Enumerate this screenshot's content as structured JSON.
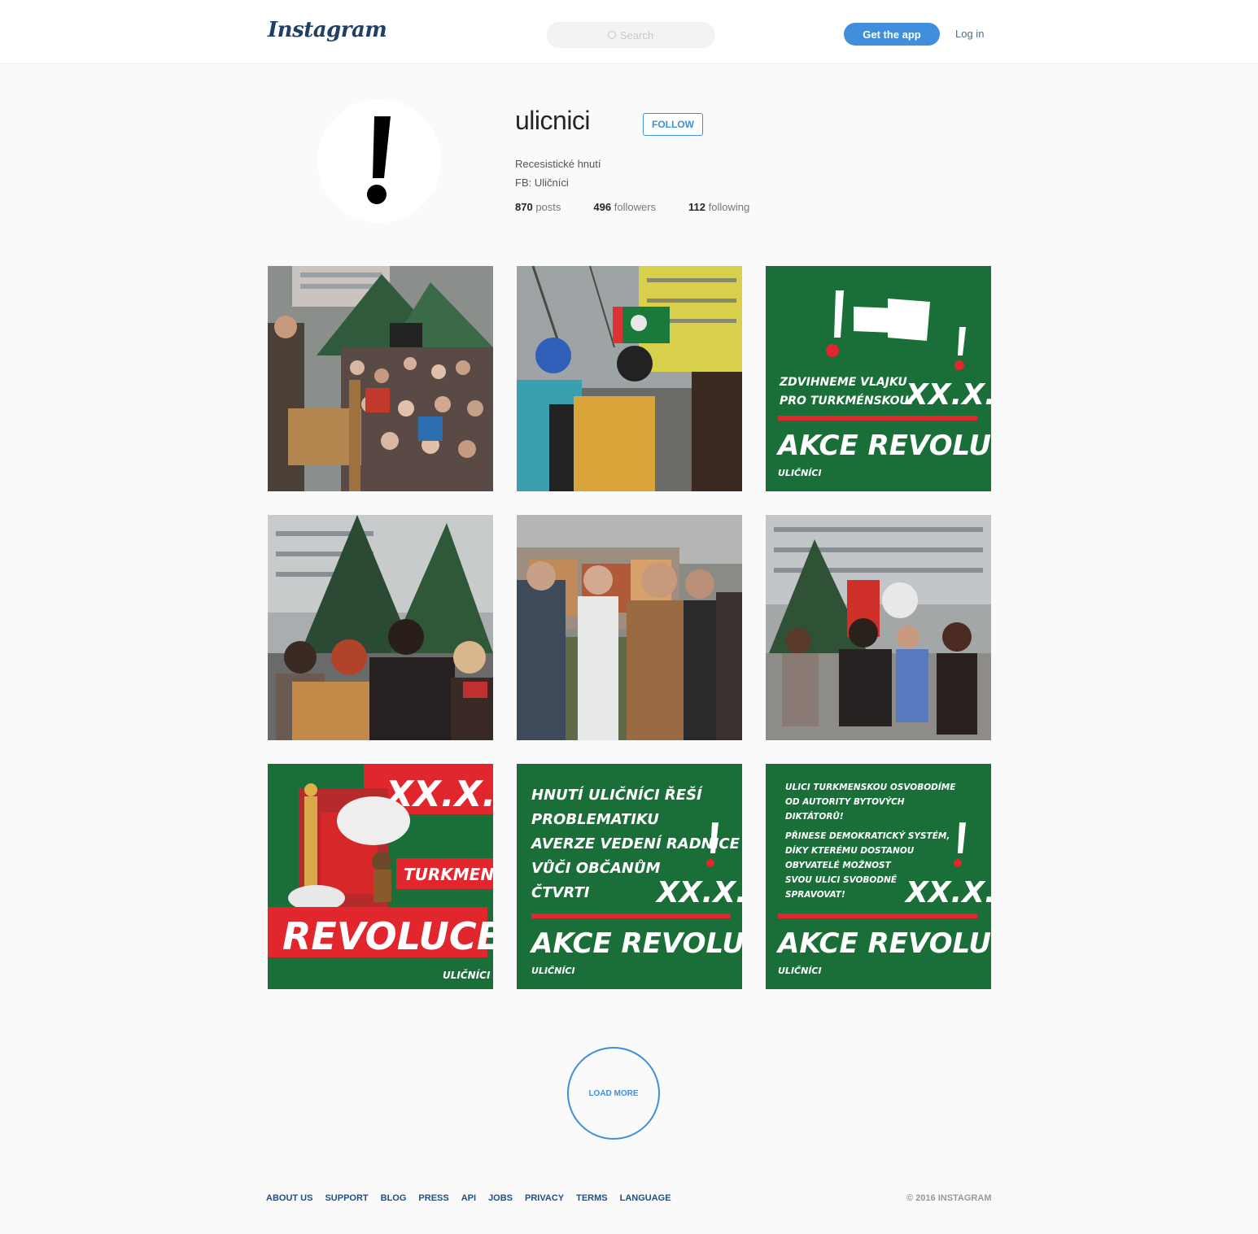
{
  "header": {
    "logo": "Instagram",
    "search_placeholder": "Search",
    "get_app": "Get the app",
    "login": "Log in"
  },
  "profile": {
    "username": "ulicnici",
    "follow": "FOLLOW",
    "bio_line1": "Recesistické hnutí",
    "bio_line2": "FB: Uličníci",
    "posts_count": "870",
    "posts_label": "posts",
    "followers_count": "496",
    "followers_label": "followers",
    "following_count": "112",
    "following_label": "following"
  },
  "posts": {
    "p3": {
      "line1": "ZDVIHNEME VLAJKU",
      "line2": "PRO TURKMÉNSKOU!",
      "date": "XX.X.",
      "headline": "AKCE REVOLUCE!",
      "sig": "ULIČNÍCI"
    },
    "p7": {
      "date": "XX.X.",
      "mid": "TURKMENSKÁ",
      "headline": "REVOLUCE!",
      "sig": "ULIČNÍCI"
    },
    "p8": {
      "l1": "HNUTÍ ULIČNÍCI ŘEŠÍ",
      "l2": "PROBLEMATIKU",
      "l3": "AVERZE VEDENÍ RADNICE",
      "l4": "VŮČI OBČANŮM",
      "l5": "ČTVRTI",
      "date": "XX.X.",
      "headline": "AKCE REVOLUCE!",
      "sig": "ULIČNÍCI"
    },
    "p9": {
      "l1": "ULICI TURKMENSKOU OSVOBODÍME",
      "l2": "OD AUTORITY BYTOVÝCH",
      "l3": "DIKTÁTORŮ!",
      "l4": "PŘINESE DEMOKRATICKÝ SYSTÉM,",
      "l5": "DÍKY KTERÉMU DOSTANOU",
      "l6": "OBYVATELÉ MOŽNOST",
      "l7": "SVOU ULICI SVOBODNĚ",
      "l8": "SPRAVOVAT!",
      "date": "XX.X.",
      "headline": "AKCE REVOLUCE!",
      "sig": "ULIČNÍCI"
    }
  },
  "load_more": "LOAD MORE",
  "footer": {
    "links": [
      "ABOUT US",
      "SUPPORT",
      "BLOG",
      "PRESS",
      "API",
      "JOBS",
      "PRIVACY",
      "TERMS",
      "LANGUAGE"
    ],
    "copyright": "© 2016 INSTAGRAM"
  },
  "colors": {
    "accent": "#3f8fdc",
    "poster_green": "#1a6f38",
    "poster_red": "#e1262d"
  }
}
